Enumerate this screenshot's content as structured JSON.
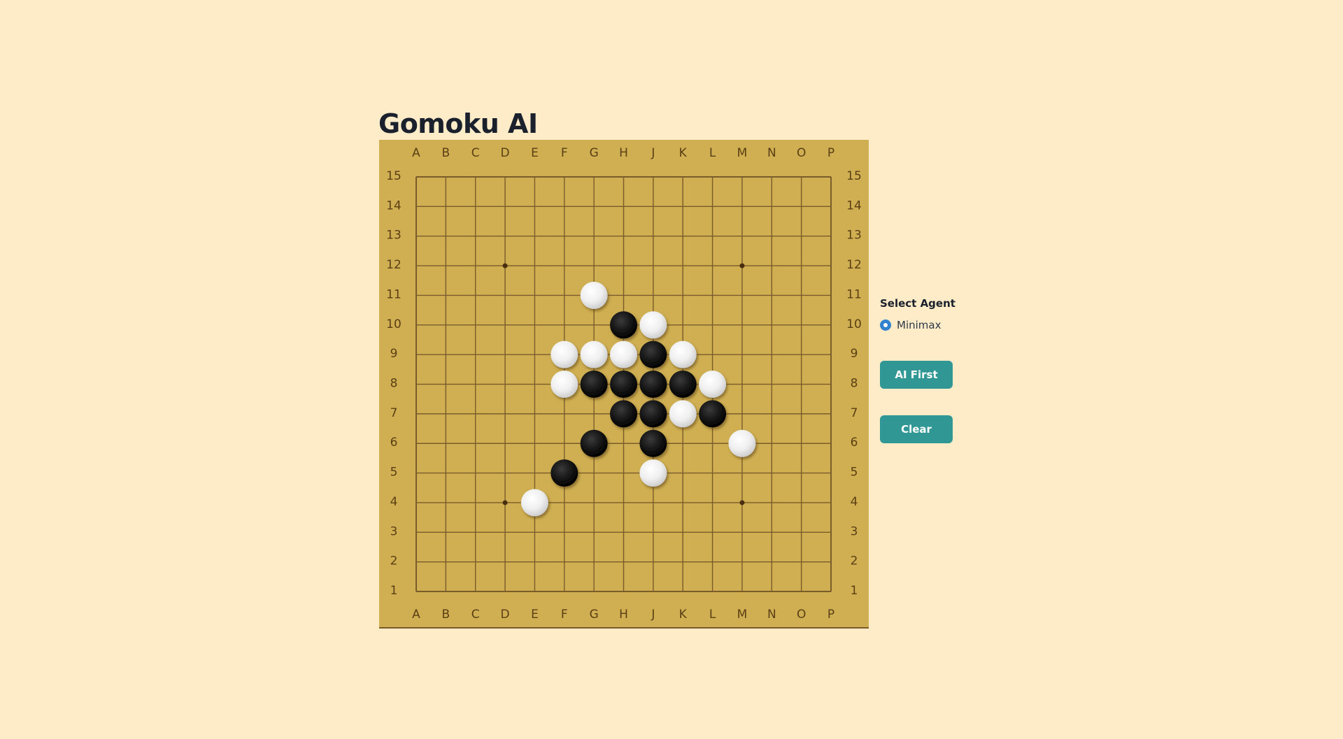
{
  "title": "Gomoku AI",
  "board": {
    "size": 15,
    "columns": [
      "A",
      "B",
      "C",
      "D",
      "E",
      "F",
      "G",
      "H",
      "J",
      "K",
      "L",
      "M",
      "N",
      "O",
      "P"
    ],
    "rows": [
      "15",
      "14",
      "13",
      "12",
      "11",
      "10",
      "9",
      "8",
      "7",
      "6",
      "5",
      "4",
      "3",
      "2",
      "1"
    ],
    "star_points": [
      "D12",
      "M12",
      "D4",
      "M4"
    ],
    "stones": [
      {
        "pos": "G11",
        "color": "white"
      },
      {
        "pos": "H10",
        "color": "black"
      },
      {
        "pos": "J10",
        "color": "white"
      },
      {
        "pos": "F9",
        "color": "white"
      },
      {
        "pos": "G9",
        "color": "white"
      },
      {
        "pos": "H9",
        "color": "white"
      },
      {
        "pos": "J9",
        "color": "black"
      },
      {
        "pos": "K9",
        "color": "white"
      },
      {
        "pos": "F8",
        "color": "white"
      },
      {
        "pos": "G8",
        "color": "black"
      },
      {
        "pos": "H8",
        "color": "black"
      },
      {
        "pos": "J8",
        "color": "black"
      },
      {
        "pos": "K8",
        "color": "black"
      },
      {
        "pos": "L8",
        "color": "white"
      },
      {
        "pos": "H7",
        "color": "black"
      },
      {
        "pos": "J7",
        "color": "black"
      },
      {
        "pos": "K7",
        "color": "white"
      },
      {
        "pos": "L7",
        "color": "black"
      },
      {
        "pos": "G6",
        "color": "black"
      },
      {
        "pos": "J6",
        "color": "black"
      },
      {
        "pos": "M6",
        "color": "white"
      },
      {
        "pos": "F5",
        "color": "black"
      },
      {
        "pos": "J5",
        "color": "white"
      },
      {
        "pos": "E4",
        "color": "white"
      }
    ],
    "colors": {
      "board": "#cfaf52",
      "grid": "#7a5c2a",
      "label": "#5b3f14"
    }
  },
  "panel": {
    "agent_label": "Select Agent",
    "agent_options": [
      {
        "label": "Minimax",
        "selected": true
      }
    ],
    "ai_first_label": "AI First",
    "clear_label": "Clear",
    "accent": "#319795"
  }
}
